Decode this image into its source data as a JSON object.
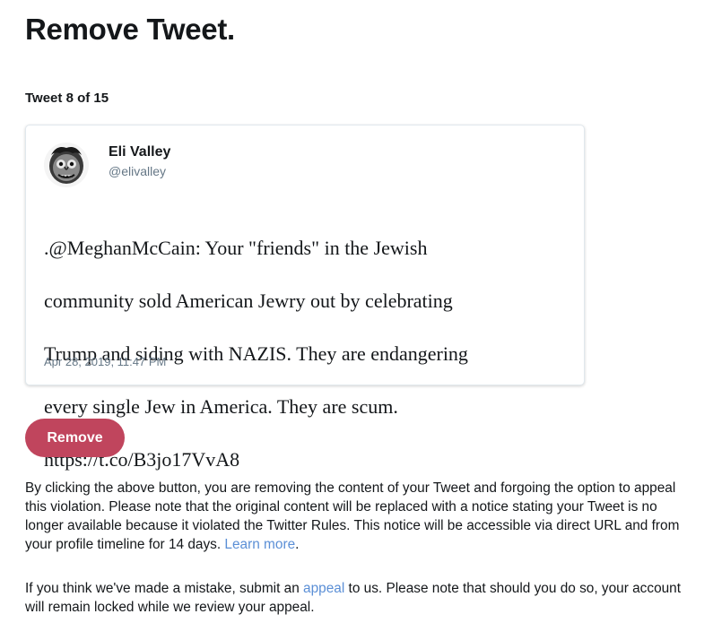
{
  "page": {
    "title": "Remove Tweet."
  },
  "counter": {
    "label": "Tweet 8 of 15"
  },
  "tweet": {
    "author_name": "Eli Valley",
    "author_handle": "@elivalley",
    "avatar_icon": "user-avatar-image",
    "text_lines": [
      ".@MeghanMcCain: Your \"friends\" in the Jewish",
      "community sold American Jewry out by celebrating",
      "Trump and siding with NAZIS. They are endangering",
      "every single Jew in America. They are scum.",
      "https://t.co/B3jo17VvA8"
    ],
    "timestamp": "Apr 28, 2019, 11:47 PM"
  },
  "actions": {
    "remove_label": "Remove",
    "remove_color": "#c0455d"
  },
  "notice": {
    "paragraph1_text": "By clicking the above button, you are removing the content of your Tweet and forgoing the option to appeal this violation. Please note that the original content will be replaced with a notice stating your Tweet is no longer available because it violated the Twitter Rules. This notice will be accessible via direct URL and from your profile timeline for 14 days.",
    "learn_more_label": "Learn more",
    "paragraph1_end": ".",
    "paragraph2_before": "If you think we've made a mistake, submit an",
    "appeal_label": "appeal",
    "paragraph2_after": "to us. Please note that should you do so, your account will remain locked while we review your appeal.",
    "link_color": "#5b8fd6"
  }
}
